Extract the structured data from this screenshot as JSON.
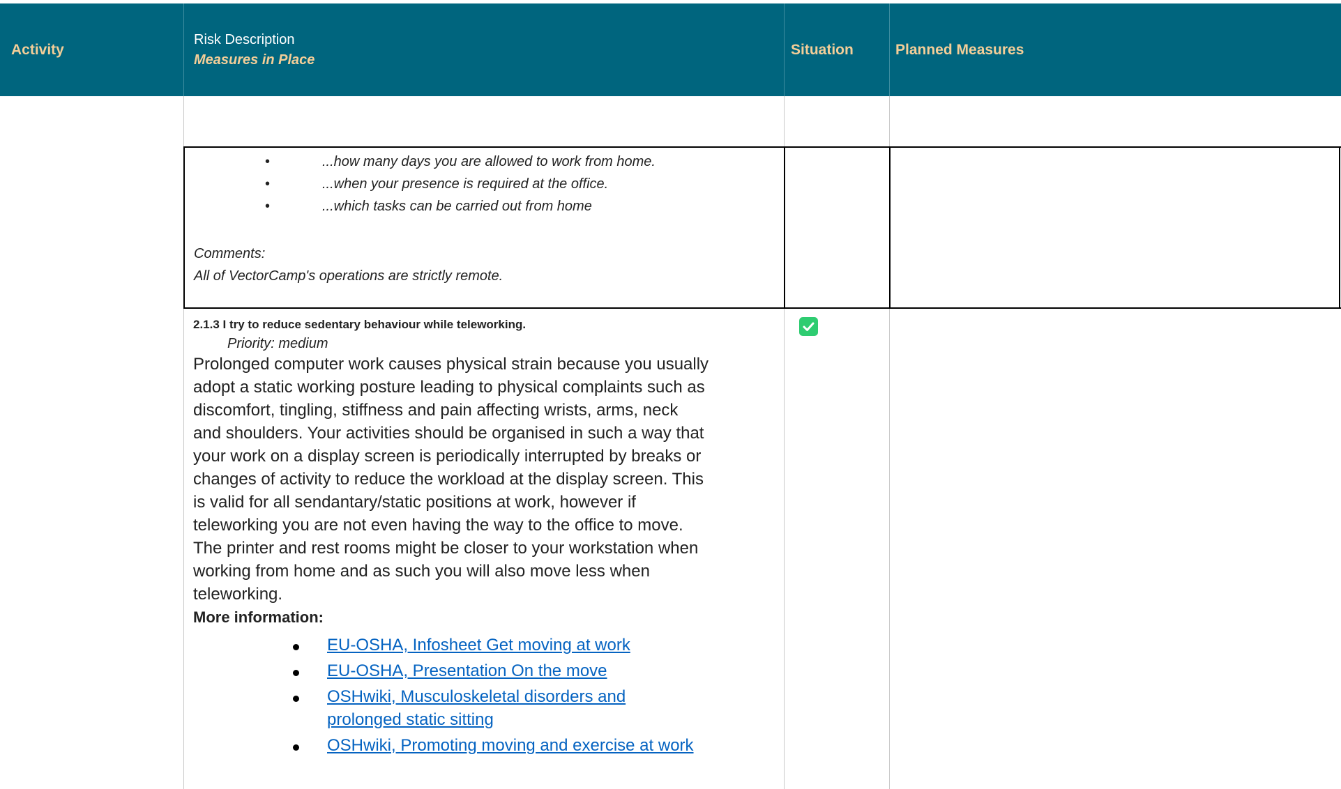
{
  "header": {
    "activity": "Activity",
    "risk_description": "Risk Description",
    "measures_in_place": "Measures in Place",
    "situation": "Situation",
    "planned_measures": "Planned Measures"
  },
  "prev_item": {
    "bullets": [
      "...how many days you are allowed to work from home.",
      "...when your presence is required at the office.",
      "...which tasks can be carried out from home"
    ],
    "comments_label": "Comments:",
    "comments_text": "All of VectorCamp's operations are strictly remote."
  },
  "item": {
    "title": "2.1.3 I try to reduce sedentary behaviour while teleworking.",
    "priority": "Priority: medium",
    "situation_checked": true,
    "body_lines": [
      "Prolonged computer work causes physical strain because you usually",
      "adopt a static working posture leading to physical complaints such as",
      "discomfort, tingling, stiffness and pain affecting wrists, arms, neck",
      "and shoulders. Your activities should be organised in such a way that",
      "your work on a display screen is periodically interrupted by breaks or",
      "changes of activity to reduce the workload at the display screen. This",
      "is valid for all sendantary/static positions at work, however if",
      "teleworking you are not even having the way to the office to move.",
      "The printer and rest rooms might be closer to your workstation when",
      "working from home and as such you will also move less when",
      "teleworking."
    ],
    "more_info_label": "More information:",
    "links": [
      "EU-OSHA, Infosheet Get moving at work",
      "EU-OSHA, Presentation On the move",
      "OSHwiki, Musculoskeletal disorders and",
      "prolonged static sitting",
      "OSHwiki, Promoting moving and exercise at work"
    ]
  },
  "colors": {
    "header_bg": "#00657e",
    "header_accent": "#f4ce98",
    "link": "#0563c1",
    "check": "#2ecc71"
  }
}
